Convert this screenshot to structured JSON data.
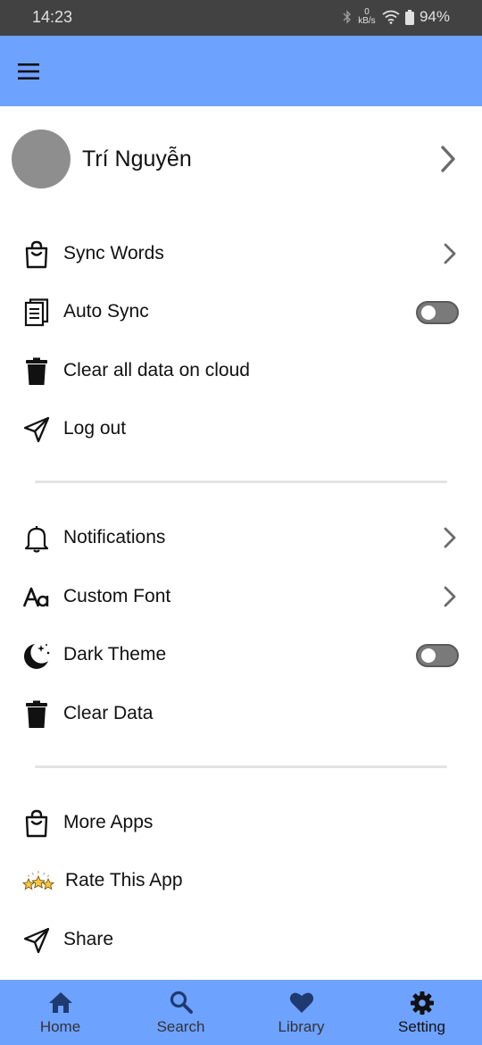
{
  "status_bar": {
    "time": "14:23",
    "net_speed_value": "0",
    "net_speed_unit": "kB/s",
    "battery": "94%"
  },
  "app_bar": {
    "menu_icon": "hamburger-menu-icon"
  },
  "profile": {
    "name": "Trí Nguyễn"
  },
  "sync_section": [
    {
      "label": "Sync Words",
      "icon": "shopping-bag-icon",
      "control": "chevron"
    },
    {
      "label": "Auto Sync",
      "icon": "document-icon",
      "control": "toggle",
      "on": false
    },
    {
      "label": "Clear all data on cloud",
      "icon": "trash-icon",
      "control": "none"
    },
    {
      "label": "Log out",
      "icon": "send-icon",
      "control": "none"
    }
  ],
  "app_section": [
    {
      "label": "Notifications",
      "icon": "bell-icon",
      "control": "chevron"
    },
    {
      "label": "Custom Font",
      "icon": "font-icon",
      "control": "chevron"
    },
    {
      "label": "Dark Theme",
      "icon": "moon-icon",
      "control": "toggle",
      "on": false
    },
    {
      "label": "Clear Data",
      "icon": "trash-icon",
      "control": "none"
    }
  ],
  "more_section": [
    {
      "label": "More Apps",
      "icon": "shopping-bag-icon"
    },
    {
      "label": "Rate This App",
      "icon": "stars-icon"
    },
    {
      "label": "Share",
      "icon": "send-icon"
    }
  ],
  "bottom_nav": {
    "items": [
      {
        "label": "Home",
        "icon": "home-icon",
        "active": false
      },
      {
        "label": "Search",
        "icon": "search-icon",
        "active": false
      },
      {
        "label": "Library",
        "icon": "heart-icon",
        "active": false
      },
      {
        "label": "Setting",
        "icon": "gear-icon",
        "active": true
      }
    ]
  },
  "colors": {
    "app_bar": "#6ea2ff",
    "status_bar": "#424242",
    "avatar": "#8e8e8e",
    "toggle_off": "#7a7a7a"
  }
}
